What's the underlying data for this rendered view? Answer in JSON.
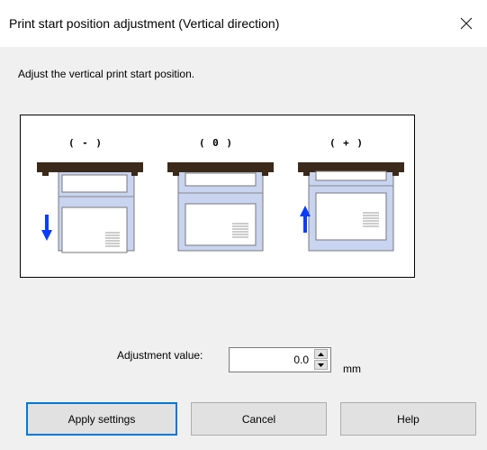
{
  "window": {
    "title": "Print start position adjustment (Vertical direction)",
    "close_icon": "close-icon"
  },
  "instruction": "Adjust the vertical print start position.",
  "illustration": {
    "positions": [
      {
        "label": "( - )",
        "arrow": "down"
      },
      {
        "label": "( 0 )",
        "arrow": "none"
      },
      {
        "label": "( + )",
        "arrow": "up"
      }
    ],
    "colors": {
      "printer_bar": "#3b2a1a",
      "paper_fill": "#c8d4f0",
      "arrow": "#0a3cff"
    }
  },
  "adjustment": {
    "label": "Adjustment value:",
    "value": "0.0",
    "unit": "mm"
  },
  "buttons": {
    "apply": "Apply settings",
    "cancel": "Cancel",
    "help": "Help"
  }
}
